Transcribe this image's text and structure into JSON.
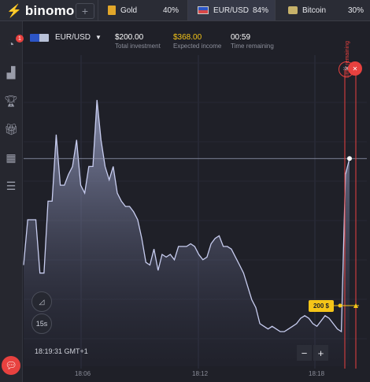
{
  "brand": {
    "name": "binomo"
  },
  "tabs": [
    {
      "name": "Gold",
      "pct": "40%"
    },
    {
      "name": "EUR/USD",
      "pct": "84%"
    },
    {
      "name": "Bitcoin",
      "pct": "30%"
    }
  ],
  "sidebar": {
    "badge": "1",
    "icons": [
      "clock-icon",
      "chart-icon",
      "trophy-icon",
      "gift-icon",
      "calendar-icon",
      "settings-sliders-icon"
    ]
  },
  "header": {
    "pair": "EUR/USD",
    "investment_value": "$200.00",
    "investment_label": "Total investment",
    "income_value": "$368.00",
    "income_label": "Expected income",
    "time_value": "00:59",
    "time_label": "Time remaining"
  },
  "chart_controls": {
    "interval": "15s",
    "clock": "18:19:31 GMT+1",
    "zoom_out": "−",
    "zoom_in": "+"
  },
  "bet_tag": "200 $",
  "time_remaining_vertical": "Time remaining",
  "timer_short": ":00",
  "close_symbol": "✕",
  "colors": {
    "accent": "#f5c518",
    "alert": "#e8413f",
    "bg": "#1f2028"
  },
  "chart_data": {
    "type": "area",
    "xticks": [
      "18:06",
      "18:12",
      "18:18"
    ],
    "y": [
      3.8,
      5.5,
      5.5,
      5.5,
      3.5,
      3.5,
      6.2,
      6.2,
      8.7,
      6.8,
      6.8,
      7.2,
      7.5,
      8.5,
      6.8,
      6.5,
      7.5,
      7.5,
      10.0,
      8.5,
      7.5,
      7.0,
      7.5,
      6.5,
      6.2,
      6.0,
      6.0,
      5.8,
      5.5,
      4.8,
      3.9,
      3.8,
      4.4,
      3.6,
      4.2,
      4.1,
      4.2,
      4.0,
      4.5,
      4.5,
      4.5,
      4.6,
      4.5,
      4.2,
      4.0,
      4.1,
      4.6,
      4.8,
      4.9,
      4.5,
      4.5,
      4.4,
      4.1,
      3.8,
      3.5,
      3.0,
      2.5,
      2.2,
      1.6,
      1.5,
      1.4,
      1.5,
      1.4,
      1.3,
      1.3,
      1.4,
      1.5,
      1.6,
      1.8,
      1.9,
      1.8,
      1.6,
      1.5,
      1.7,
      1.9,
      1.8,
      1.6,
      1.4,
      1.3,
      7.2,
      7.8
    ],
    "current_price_line": 7.8,
    "expiry_marker": "18:19:31"
  }
}
